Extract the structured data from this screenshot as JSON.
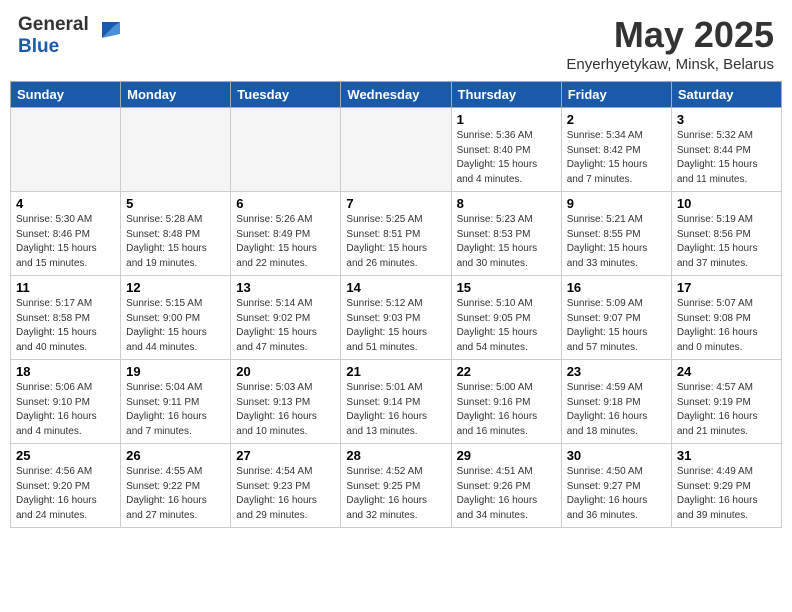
{
  "header": {
    "logo_general": "General",
    "logo_blue": "Blue",
    "month_title": "May 2025",
    "location": "Enyerhyetykaw, Minsk, Belarus"
  },
  "weekdays": [
    "Sunday",
    "Monday",
    "Tuesday",
    "Wednesday",
    "Thursday",
    "Friday",
    "Saturday"
  ],
  "weeks": [
    [
      {
        "day": "",
        "info": ""
      },
      {
        "day": "",
        "info": ""
      },
      {
        "day": "",
        "info": ""
      },
      {
        "day": "",
        "info": ""
      },
      {
        "day": "1",
        "info": "Sunrise: 5:36 AM\nSunset: 8:40 PM\nDaylight: 15 hours\nand 4 minutes."
      },
      {
        "day": "2",
        "info": "Sunrise: 5:34 AM\nSunset: 8:42 PM\nDaylight: 15 hours\nand 7 minutes."
      },
      {
        "day": "3",
        "info": "Sunrise: 5:32 AM\nSunset: 8:44 PM\nDaylight: 15 hours\nand 11 minutes."
      }
    ],
    [
      {
        "day": "4",
        "info": "Sunrise: 5:30 AM\nSunset: 8:46 PM\nDaylight: 15 hours\nand 15 minutes."
      },
      {
        "day": "5",
        "info": "Sunrise: 5:28 AM\nSunset: 8:48 PM\nDaylight: 15 hours\nand 19 minutes."
      },
      {
        "day": "6",
        "info": "Sunrise: 5:26 AM\nSunset: 8:49 PM\nDaylight: 15 hours\nand 22 minutes."
      },
      {
        "day": "7",
        "info": "Sunrise: 5:25 AM\nSunset: 8:51 PM\nDaylight: 15 hours\nand 26 minutes."
      },
      {
        "day": "8",
        "info": "Sunrise: 5:23 AM\nSunset: 8:53 PM\nDaylight: 15 hours\nand 30 minutes."
      },
      {
        "day": "9",
        "info": "Sunrise: 5:21 AM\nSunset: 8:55 PM\nDaylight: 15 hours\nand 33 minutes."
      },
      {
        "day": "10",
        "info": "Sunrise: 5:19 AM\nSunset: 8:56 PM\nDaylight: 15 hours\nand 37 minutes."
      }
    ],
    [
      {
        "day": "11",
        "info": "Sunrise: 5:17 AM\nSunset: 8:58 PM\nDaylight: 15 hours\nand 40 minutes."
      },
      {
        "day": "12",
        "info": "Sunrise: 5:15 AM\nSunset: 9:00 PM\nDaylight: 15 hours\nand 44 minutes."
      },
      {
        "day": "13",
        "info": "Sunrise: 5:14 AM\nSunset: 9:02 PM\nDaylight: 15 hours\nand 47 minutes."
      },
      {
        "day": "14",
        "info": "Sunrise: 5:12 AM\nSunset: 9:03 PM\nDaylight: 15 hours\nand 51 minutes."
      },
      {
        "day": "15",
        "info": "Sunrise: 5:10 AM\nSunset: 9:05 PM\nDaylight: 15 hours\nand 54 minutes."
      },
      {
        "day": "16",
        "info": "Sunrise: 5:09 AM\nSunset: 9:07 PM\nDaylight: 15 hours\nand 57 minutes."
      },
      {
        "day": "17",
        "info": "Sunrise: 5:07 AM\nSunset: 9:08 PM\nDaylight: 16 hours\nand 0 minutes."
      }
    ],
    [
      {
        "day": "18",
        "info": "Sunrise: 5:06 AM\nSunset: 9:10 PM\nDaylight: 16 hours\nand 4 minutes."
      },
      {
        "day": "19",
        "info": "Sunrise: 5:04 AM\nSunset: 9:11 PM\nDaylight: 16 hours\nand 7 minutes."
      },
      {
        "day": "20",
        "info": "Sunrise: 5:03 AM\nSunset: 9:13 PM\nDaylight: 16 hours\nand 10 minutes."
      },
      {
        "day": "21",
        "info": "Sunrise: 5:01 AM\nSunset: 9:14 PM\nDaylight: 16 hours\nand 13 minutes."
      },
      {
        "day": "22",
        "info": "Sunrise: 5:00 AM\nSunset: 9:16 PM\nDaylight: 16 hours\nand 16 minutes."
      },
      {
        "day": "23",
        "info": "Sunrise: 4:59 AM\nSunset: 9:18 PM\nDaylight: 16 hours\nand 18 minutes."
      },
      {
        "day": "24",
        "info": "Sunrise: 4:57 AM\nSunset: 9:19 PM\nDaylight: 16 hours\nand 21 minutes."
      }
    ],
    [
      {
        "day": "25",
        "info": "Sunrise: 4:56 AM\nSunset: 9:20 PM\nDaylight: 16 hours\nand 24 minutes."
      },
      {
        "day": "26",
        "info": "Sunrise: 4:55 AM\nSunset: 9:22 PM\nDaylight: 16 hours\nand 27 minutes."
      },
      {
        "day": "27",
        "info": "Sunrise: 4:54 AM\nSunset: 9:23 PM\nDaylight: 16 hours\nand 29 minutes."
      },
      {
        "day": "28",
        "info": "Sunrise: 4:52 AM\nSunset: 9:25 PM\nDaylight: 16 hours\nand 32 minutes."
      },
      {
        "day": "29",
        "info": "Sunrise: 4:51 AM\nSunset: 9:26 PM\nDaylight: 16 hours\nand 34 minutes."
      },
      {
        "day": "30",
        "info": "Sunrise: 4:50 AM\nSunset: 9:27 PM\nDaylight: 16 hours\nand 36 minutes."
      },
      {
        "day": "31",
        "info": "Sunrise: 4:49 AM\nSunset: 9:29 PM\nDaylight: 16 hours\nand 39 minutes."
      }
    ]
  ]
}
